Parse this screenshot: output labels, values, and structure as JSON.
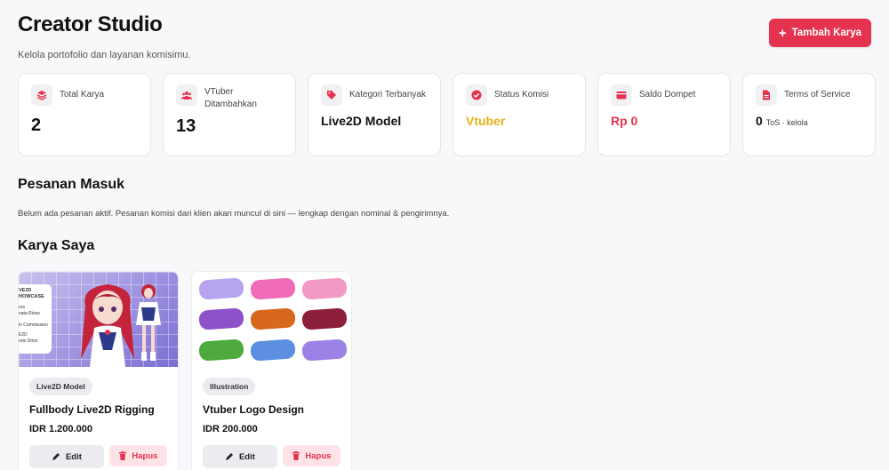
{
  "header": {
    "title": "Creator Studio",
    "subtitle": "Kelola portofolio dan layanan komisimu.",
    "add_button": "Tambah Karya"
  },
  "colors": {
    "accent": "#e5334f",
    "yellow": "#e6b21a"
  },
  "stats": [
    {
      "label": "Total Karya",
      "value": "2",
      "icon": "layers-icon"
    },
    {
      "label": "VTuber Ditambahkan",
      "value": "13",
      "icon": "users-icon"
    },
    {
      "label": "Kategori Terbanyak",
      "value": "Live2D Model",
      "icon": "tag-icon"
    },
    {
      "label": "Status Komisi",
      "value": "Vtuber",
      "icon": "check-circle-icon"
    },
    {
      "label": "Saldo Dompet",
      "value": "Rp 0",
      "icon": "wallet-icon"
    },
    {
      "label": "Terms of Service",
      "value": "0",
      "suffix": "ToS · kelola",
      "icon": "file-icon"
    }
  ],
  "orders": {
    "title": "Pesanan Masuk",
    "empty": "Belum ada pesanan aktif. Pesanan komisi dari klien akan muncul di sini — lengkap dengan nominal & pengirimnya."
  },
  "works": {
    "title": "Karya Saya",
    "items": [
      {
        "category": "Live2D Model",
        "name": "Fullbody Live2D Rigging",
        "price": "IDR 1.200.000",
        "edit": "Edit",
        "delete": "Hapus"
      },
      {
        "category": "Illustration",
        "name": "Vtuber Logo Design",
        "price": "IDR 200.000",
        "edit": "Edit",
        "delete": "Hapus"
      }
    ]
  }
}
